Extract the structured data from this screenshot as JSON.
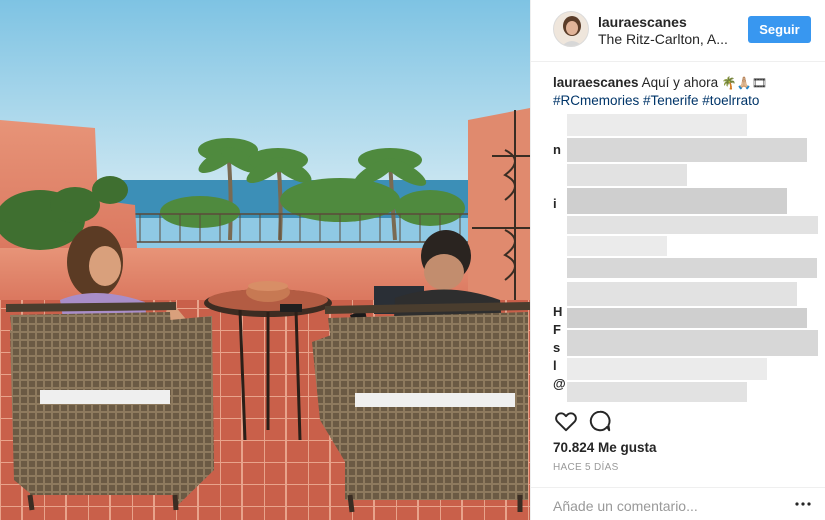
{
  "post": {
    "username": "lauraescanes",
    "location": "The Ritz-Carlton, A...",
    "follow_label": "Seguir",
    "caption": {
      "username": "lauraescanes",
      "text": "Aquí y ahora",
      "emojis": "🌴🙏🏼🎞",
      "hashtags": "#RCmemories #Tenerife #toelrrato"
    },
    "comment_initials": [
      "n",
      "i",
      "",
      "",
      "",
      "H",
      "F",
      "s",
      "l",
      "@"
    ],
    "like_count": "70.824 Me gusta",
    "timestamp": "HACE 5 DÍAS",
    "comment_placeholder": "Añade un comentario...",
    "icons": {
      "like": "heart-icon",
      "comment": "speech-bubble-icon",
      "more": "ellipsis-icon"
    }
  },
  "colors": {
    "follow_button": "#3897f0",
    "hashtag": "#003569",
    "muted": "#999999"
  }
}
